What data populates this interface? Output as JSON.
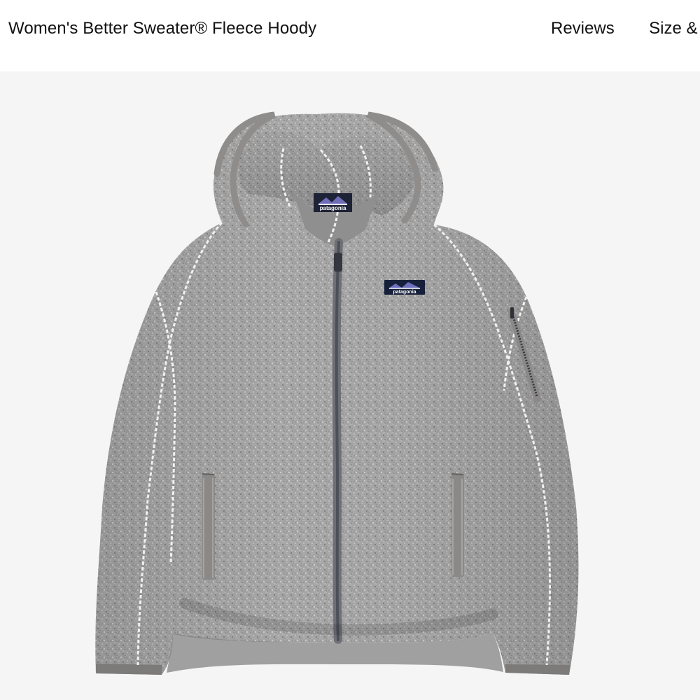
{
  "header": {
    "product_title": "Women's Better Sweater® Fleece Hoody",
    "nav": {
      "reviews_label": "Reviews",
      "size_fit_label": "Size & F"
    }
  },
  "product_image": {
    "subject": "hooded fleece jacket",
    "colors": {
      "background": "#f5f5f5",
      "fleece": "#a8a8a8",
      "fleece_dark": "#8f8f8f",
      "trim": "#7d7b7a",
      "zipper": "#53565d",
      "stitching": "#f3f3f3",
      "label_navy": "#17203a"
    },
    "logo_text": "patagonia"
  }
}
